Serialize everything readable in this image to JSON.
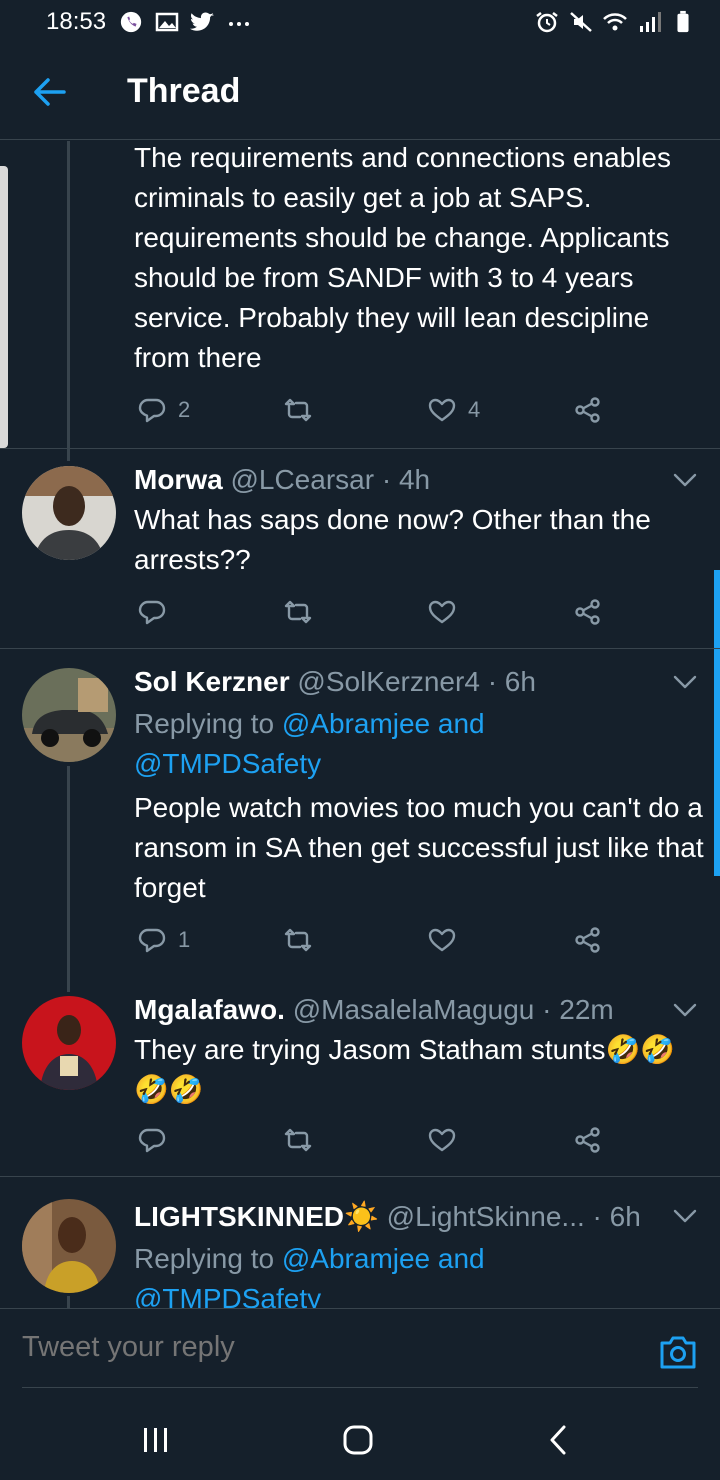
{
  "status_bar": {
    "time": "18:53",
    "left_icons": [
      "viber-icon",
      "gallery-icon",
      "twitter-icon",
      "more-dots-icon"
    ],
    "right_icons": [
      "alarm-icon",
      "mute-icon",
      "wifi-icon",
      "signal-icon",
      "battery-icon"
    ]
  },
  "header": {
    "title": "Thread"
  },
  "tweets": [
    {
      "text": "The requirements and connections enables criminals to easily get a job at SAPS. requirements should be change. Applicants should be from SANDF with 3 to 4 years service. Probably they will lean descipline from there",
      "replies": "2",
      "retweets": "",
      "likes": "4"
    },
    {
      "name": "Morwa",
      "handle": "@LCearsar",
      "time": "· 4h",
      "text": "What has saps done now? Other than the arrests??",
      "replies": "",
      "retweets": "",
      "likes": ""
    },
    {
      "name": "Sol Kerzner",
      "handle": "@SolKerzner4",
      "time": "· 6h",
      "replying_prefix": "Replying to ",
      "replying_mentions": "@Abramjee and @TMPDSafety",
      "text": "People watch movies too much you can't do a ransom in SA then get successful just like that forget",
      "replies": "1",
      "retweets": "",
      "likes": ""
    },
    {
      "name": "Mgalafawo.",
      "handle": "@MasalelaMagugu",
      "time": "· 22m",
      "text": "They are trying Jasom Statham stunts🤣🤣🤣🤣",
      "replies": "",
      "retweets": "",
      "likes": ""
    },
    {
      "name": "LIGHTSKINNED☀️",
      "handle": "@LightSkinne...",
      "time": "· 6h",
      "replying_prefix": "Replying to ",
      "replying_mentions": "@Abramjee and @TMPDSafety"
    }
  ],
  "compose": {
    "placeholder": "Tweet your reply"
  },
  "colors": {
    "background": "#15202b",
    "accent": "#1da1f2",
    "muted": "#8899a6",
    "divider": "#38444d"
  }
}
